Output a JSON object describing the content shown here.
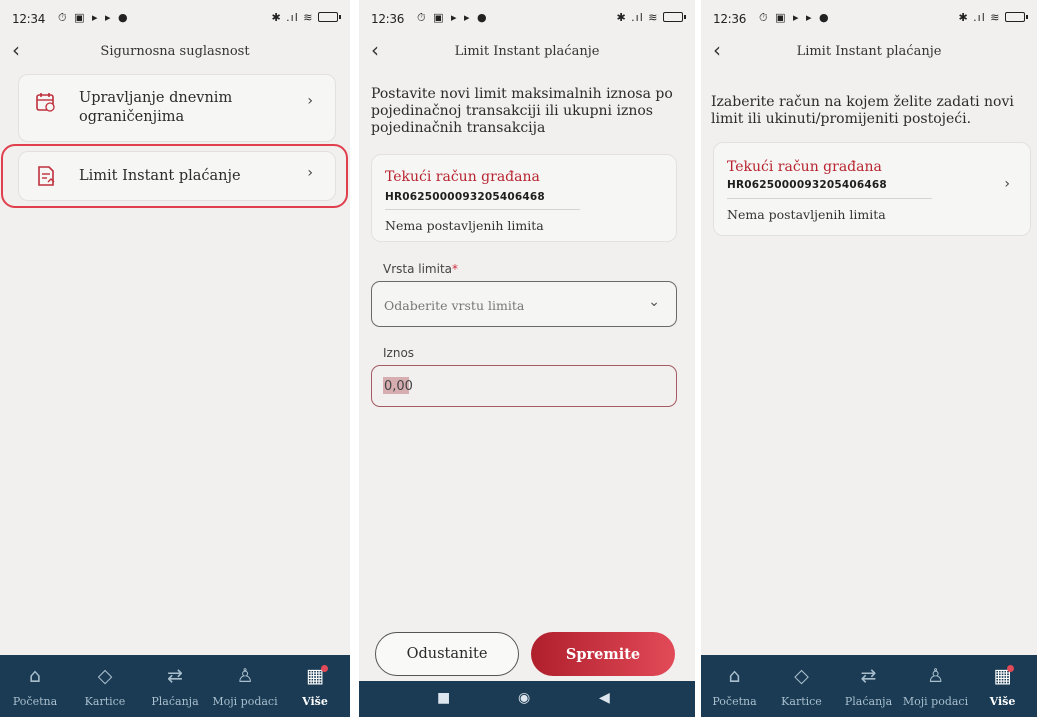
{
  "screen1": {
    "status": {
      "time": "12:34",
      "left_icons": "⏱ ▣ ▸ ▸ ●",
      "right_icons": "✱ .ıl ≋"
    },
    "title": "Sigurnosna suglasnost",
    "menu": [
      {
        "label_line1": "Upravljanje dnevnim",
        "label_line2": "ograničenjima"
      },
      {
        "label_line1": "Limit Instant plaćanje",
        "label_line2": ""
      }
    ]
  },
  "screen2": {
    "status": {
      "time": "12:36",
      "left_icons": "⏱ ▣ ▸ ▸ ●",
      "right_icons": "✱ .ıl ≋"
    },
    "title": "Limit Instant plaćanje",
    "intro": [
      "Postavite novi limit maksimalnih iznosa po",
      "pojedinačnoj transakciji ili ukupni iznos",
      "pojedinačnih transakcija"
    ],
    "account": {
      "name": "Tekući račun građana",
      "iban": "HR0625000093205406468",
      "note": "Nema postavljenih limita"
    },
    "limit_type": {
      "label": "Vrsta limita",
      "required": "*",
      "placeholder": "Odaberite vrstu limita"
    },
    "amount": {
      "label": "Iznos",
      "value": "0,00"
    },
    "buttons": {
      "cancel": "Odustanite",
      "save": "Spremite"
    }
  },
  "screen3": {
    "status": {
      "time": "12:36",
      "left_icons": "⏱ ▣ ▸ ▸ ●",
      "right_icons": "✱ .ıl ≋"
    },
    "title": "Limit Instant plaćanje",
    "intro": [
      "Izaberite račun na kojem želite zadati novi",
      "limit ili ukinuti/promijeniti postojeći."
    ],
    "account": {
      "name": "Tekući račun građana",
      "iban": "HR0625000093205406468",
      "note": "Nema postavljenih limita"
    }
  },
  "tabbar": {
    "items": [
      {
        "label": "Početna",
        "icon": "home-icon"
      },
      {
        "label": "Kartice",
        "icon": "card-icon"
      },
      {
        "label": "Plaćanja",
        "icon": "transfer-icon"
      },
      {
        "label": "Moji podaci",
        "icon": "user-icon"
      },
      {
        "label": "Više",
        "icon": "grid-icon"
      }
    ],
    "active": "Više"
  },
  "colors": {
    "accent": "#b8242f",
    "tabbar": "#1a3b53",
    "highlight": "#e0404d"
  }
}
